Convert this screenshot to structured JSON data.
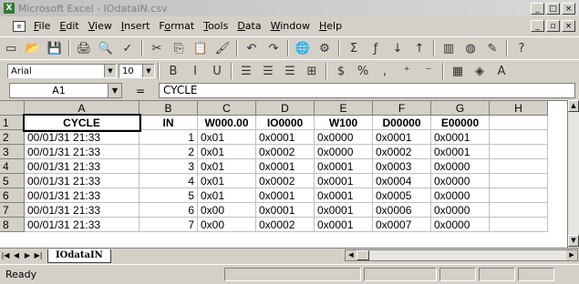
{
  "window": {
    "title": "Microsoft Excel - IOdataIN.csv",
    "app_icon": "excel-icon"
  },
  "window_buttons": [
    "_",
    "□",
    "×"
  ],
  "menubar": {
    "items": [
      {
        "pre": "",
        "u": "F",
        "post": "ile"
      },
      {
        "pre": "",
        "u": "E",
        "post": "dit"
      },
      {
        "pre": "",
        "u": "V",
        "post": "iew"
      },
      {
        "pre": "",
        "u": "I",
        "post": "nsert"
      },
      {
        "pre": "F",
        "u": "o",
        "post": "rmat"
      },
      {
        "pre": "",
        "u": "T",
        "post": "ools"
      },
      {
        "pre": "",
        "u": "D",
        "post": "ata"
      },
      {
        "pre": "",
        "u": "W",
        "post": "indow"
      },
      {
        "pre": "",
        "u": "H",
        "post": "elp"
      }
    ],
    "doc_buttons": [
      "_",
      "▫",
      "×"
    ]
  },
  "standard_toolbar": [
    {
      "name": "new-icon",
      "glyph": "▭"
    },
    {
      "name": "open-icon",
      "glyph": "📂"
    },
    {
      "name": "save-icon",
      "glyph": "💾"
    },
    {
      "sep": true
    },
    {
      "name": "print-icon",
      "glyph": "🖨"
    },
    {
      "name": "print-preview-icon",
      "glyph": "🔍"
    },
    {
      "name": "spelling-icon",
      "glyph": "✓"
    },
    {
      "sep": true
    },
    {
      "name": "cut-icon",
      "glyph": "✂"
    },
    {
      "name": "copy-icon",
      "glyph": "⎘"
    },
    {
      "name": "paste-icon",
      "glyph": "📋"
    },
    {
      "name": "format-painter-icon",
      "glyph": "🖌"
    },
    {
      "sep": true
    },
    {
      "name": "undo-icon",
      "glyph": "↶"
    },
    {
      "name": "redo-icon",
      "glyph": "↷"
    },
    {
      "sep": true
    },
    {
      "name": "hyperlink-icon",
      "glyph": "🌐"
    },
    {
      "name": "web-icon",
      "glyph": "⚙"
    },
    {
      "sep": true
    },
    {
      "name": "autosum-icon",
      "glyph": "Σ"
    },
    {
      "name": "function-icon",
      "glyph": "ƒ"
    },
    {
      "name": "sort-asc-icon",
      "glyph": "↓"
    },
    {
      "name": "sort-desc-icon",
      "glyph": "↑"
    },
    {
      "sep": true
    },
    {
      "name": "chart-wizard-icon",
      "glyph": "▥"
    },
    {
      "name": "map-icon",
      "glyph": "◍"
    },
    {
      "name": "drawing-icon",
      "glyph": "✎"
    },
    {
      "sep": true
    },
    {
      "name": "help-icon",
      "glyph": "?"
    }
  ],
  "format_toolbar": {
    "font": "Arial",
    "size": "10",
    "buttons": [
      {
        "name": "bold-icon",
        "glyph": "B"
      },
      {
        "name": "italic-icon",
        "glyph": "I"
      },
      {
        "name": "underline-icon",
        "glyph": "U"
      },
      {
        "sep": true
      },
      {
        "name": "align-left-icon",
        "glyph": "☰"
      },
      {
        "name": "align-center-icon",
        "glyph": "☰"
      },
      {
        "name": "align-right-icon",
        "glyph": "☰"
      },
      {
        "name": "merge-center-icon",
        "glyph": "⊞"
      },
      {
        "sep": true
      },
      {
        "name": "currency-icon",
        "glyph": "$"
      },
      {
        "name": "percent-icon",
        "glyph": "%"
      },
      {
        "name": "comma-icon",
        "glyph": ","
      },
      {
        "name": "increase-decimal-icon",
        "glyph": "⁺"
      },
      {
        "name": "decrease-decimal-icon",
        "glyph": "⁻"
      },
      {
        "sep": true
      },
      {
        "name": "borders-icon",
        "glyph": "▦"
      },
      {
        "name": "fill-color-icon",
        "glyph": "◈"
      },
      {
        "name": "font-color-icon",
        "glyph": "A"
      }
    ]
  },
  "formula_bar": {
    "cell_ref": "A1",
    "fx": "=",
    "content": "CYCLE"
  },
  "sheet": {
    "columns": [
      "A",
      "B",
      "C",
      "D",
      "E",
      "F",
      "G",
      "H"
    ],
    "rows": [
      {
        "n": "1",
        "cells": [
          "CYCLE",
          "IN",
          "W000.00",
          "IO0000",
          "W100",
          "D00000",
          "E00000",
          ""
        ]
      },
      {
        "n": "2",
        "cells": [
          "00/01/31 21:33",
          "1",
          "0x01",
          "0x0001",
          "0x0000",
          "0x0001",
          "0x0001",
          ""
        ]
      },
      {
        "n": "3",
        "cells": [
          "00/01/31 21:33",
          "2",
          "0x01",
          "0x0002",
          "0x0000",
          "0x0002",
          "0x0001",
          ""
        ]
      },
      {
        "n": "4",
        "cells": [
          "00/01/31 21:33",
          "3",
          "0x01",
          "0x0001",
          "0x0001",
          "0x0003",
          "0x0000",
          ""
        ]
      },
      {
        "n": "5",
        "cells": [
          "00/01/31 21:33",
          "4",
          "0x01",
          "0x0002",
          "0x0001",
          "0x0004",
          "0x0000",
          ""
        ]
      },
      {
        "n": "6",
        "cells": [
          "00/01/31 21:33",
          "5",
          "0x01",
          "0x0001",
          "0x0001",
          "0x0005",
          "0x0000",
          ""
        ]
      },
      {
        "n": "7",
        "cells": [
          "00/01/31 21:33",
          "6",
          "0x00",
          "0x0001",
          "0x0001",
          "0x0006",
          "0x0000",
          ""
        ]
      },
      {
        "n": "8",
        "cells": [
          "00/01/31 21:33",
          "7",
          "0x00",
          "0x0002",
          "0x0001",
          "0x0007",
          "0x0000",
          ""
        ]
      }
    ]
  },
  "sheet_tab": "IOdataIN",
  "status": "Ready"
}
